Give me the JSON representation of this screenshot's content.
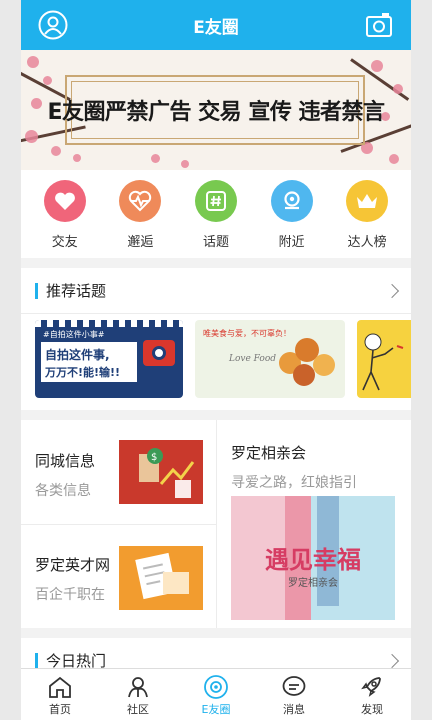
{
  "header": {
    "title": "E友圈",
    "left_icon": "user-avatar-icon",
    "right_icon": "camera-icon"
  },
  "banner": {
    "text": "E友圈严禁广告 交易 宣传 违者禁言"
  },
  "quick": [
    {
      "label": "交友",
      "icon": "heart-icon",
      "color": "#f0657a"
    },
    {
      "label": "邂逅",
      "icon": "pulse-heart-icon",
      "color": "#ef8a5a"
    },
    {
      "label": "话题",
      "icon": "hashtag-icon",
      "color": "#78c94f"
    },
    {
      "label": "附近",
      "icon": "location-icon",
      "color": "#4fb7ef"
    },
    {
      "label": "达人榜",
      "icon": "crown-icon",
      "color": "#f6c536"
    }
  ],
  "recommend": {
    "title": "推荐话题",
    "cards": [
      {
        "tag": "#自拍这件小事#",
        "line1": "自拍这件事,",
        "line2": "万万不!能!输!!"
      },
      {
        "caption": "唯美食与爱，不可辜负！",
        "script": "Love Food"
      },
      {
        "caption": ""
      }
    ]
  },
  "grid": {
    "city": {
      "title": "同城信息",
      "sub": "各类信息"
    },
    "talent": {
      "title": "罗定英才网",
      "sub": "百企千职在"
    },
    "match": {
      "title": "罗定相亲会",
      "sub": "寻爱之路，红娘指引",
      "poster_main": "遇见幸福",
      "poster_sub": "罗定相亲会"
    }
  },
  "hot": {
    "title": "今日热门"
  },
  "tabs": [
    {
      "label": "首页",
      "icon": "home-icon"
    },
    {
      "label": "社区",
      "icon": "community-icon"
    },
    {
      "label": "E友圈",
      "icon": "eyou-circle-icon",
      "active": true
    },
    {
      "label": "消息",
      "icon": "message-icon"
    },
    {
      "label": "发现",
      "icon": "rocket-icon"
    }
  ],
  "colors": {
    "accent": "#1fb1ec"
  }
}
